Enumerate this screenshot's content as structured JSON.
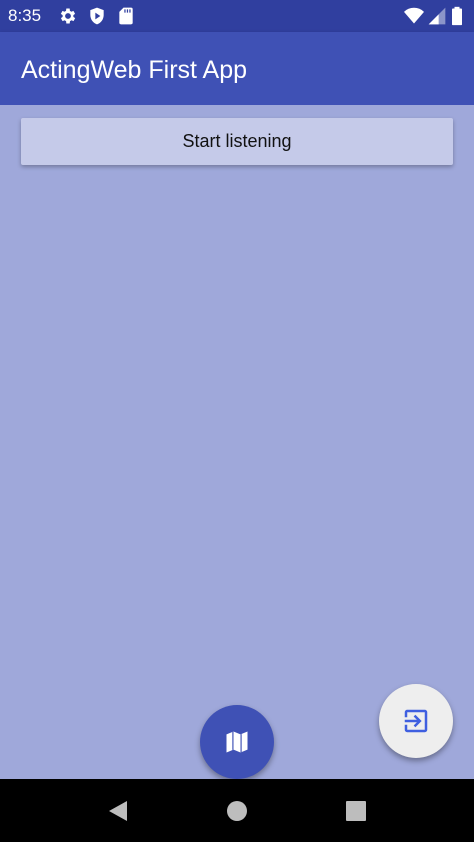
{
  "status_bar": {
    "time": "8:35",
    "icons": [
      "gear-icon",
      "shield-play-icon",
      "sd-card-icon",
      "wifi-icon",
      "signal-icon",
      "battery-icon"
    ]
  },
  "app_bar": {
    "title": "ActingWeb First App"
  },
  "main": {
    "start_button_label": "Start listening"
  },
  "fabs": {
    "map_icon": "map-icon",
    "exit_icon": "exit-to-app-icon"
  },
  "nav": {
    "icons": [
      "back-icon",
      "home-icon",
      "recents-icon"
    ]
  },
  "colors": {
    "primary": "#3f51b5",
    "primary_dark": "#303f9f",
    "background": "#9fa8da",
    "button": "#c5cae9",
    "fab_light": "#eeeeee"
  }
}
